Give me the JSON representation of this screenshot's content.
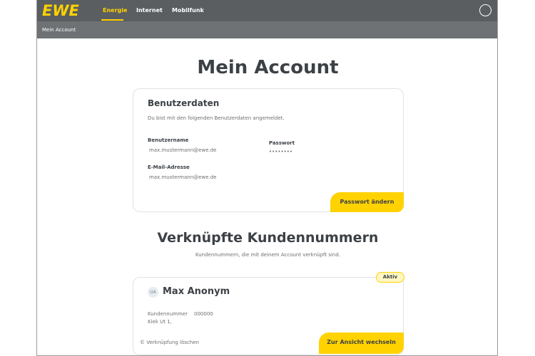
{
  "header": {
    "logo": "EWE",
    "nav": [
      {
        "label": "Energie",
        "active": true
      },
      {
        "label": "Internet",
        "active": false
      },
      {
        "label": "Mobilfunk",
        "active": false
      }
    ],
    "profile_icon": "user-circle-icon"
  },
  "breadcrumb": {
    "label": "Mein Account"
  },
  "page_title": "Mein Account",
  "user_card": {
    "title": "Benutzerdaten",
    "subtitle": "Du bist mit den folgenden Benutzerdaten angemeldet.",
    "username_label": "Benutzername",
    "username_value": "max.mustermann@ewe.de",
    "password_label": "Passwort",
    "password_value": "••••••••",
    "email_label": "E-Mail-Adresse",
    "email_value": "max.mustermann@ewe.de",
    "change_password_label": "Passwort ändern"
  },
  "linked": {
    "title": "Verknüpfte Kundennummern",
    "subtitle": "Kundennummern, die mit deinem Account verknüpft sind."
  },
  "customer_card": {
    "badge": "Aktiv",
    "avatar_initials": "UA",
    "name": "Max  Anonym",
    "number_label": "Kundennummer",
    "number_value": "000000",
    "address": "Kiek Ut 1,",
    "unlink_label": "© Verknüpfung löschen",
    "switch_label": "Zur Ansicht wechseln"
  },
  "colors": {
    "accent": "#ffd200",
    "topbar": "#5a5e61",
    "subbar": "#6e7275",
    "text": "#3c4146"
  }
}
